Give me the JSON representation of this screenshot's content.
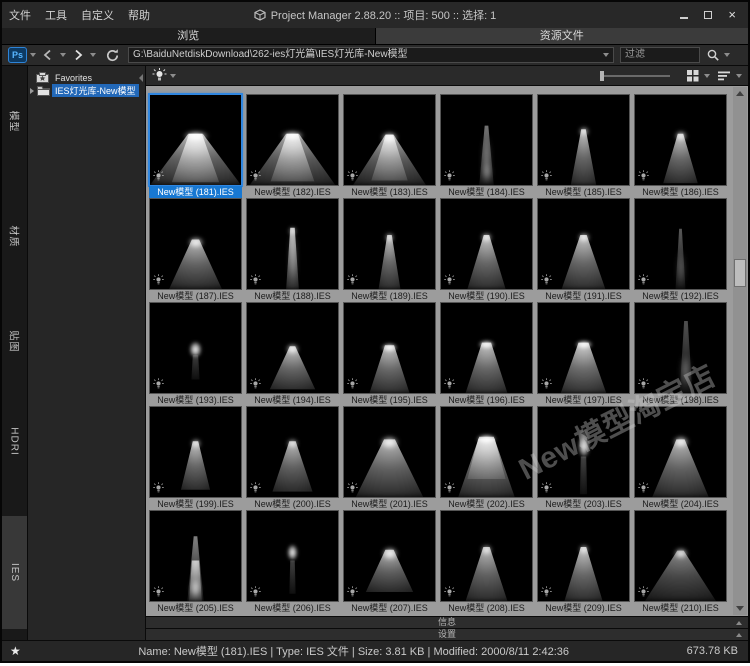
{
  "window": {
    "title": "Project Manager 2.88.20  ::  项目: 500  ::  选择: 1",
    "close": "×"
  },
  "menu": {
    "items": [
      "文件",
      "工具",
      "自定义",
      "帮助"
    ]
  },
  "tabs": [
    {
      "label": "浏览",
      "active": true
    },
    {
      "label": "资源文件",
      "active": false
    }
  ],
  "toolbar": {
    "ps_label": "Ps",
    "path": "G:\\BaiduNetdiskDownload\\262-ies灯光篇\\IES灯光库-New模型",
    "filter_placeholder": "过滤"
  },
  "side_tabs": [
    {
      "label": "模型",
      "active": false
    },
    {
      "label": "材质",
      "active": false
    },
    {
      "label": "贴图",
      "active": false
    },
    {
      "label": "HDRI",
      "active": false
    },
    {
      "label": "IES",
      "active": true
    }
  ],
  "tree": {
    "favorites": "Favorites",
    "folder": "IES灯光库-New模型"
  },
  "panels": {
    "info": "信息",
    "settings": "设置"
  },
  "status": {
    "star": "★",
    "text": "Name: New模型 (181).IES | Type: IES 文件 | Size: 3.81 KB | Modified: 2000/8/11 2:42:36",
    "total_size": "673.78 KB"
  },
  "watermark": "New模型淘宝店",
  "colors": {
    "selection_blue": "#1878d2",
    "grid_bg": "#9c9c9c",
    "thumb_bg": "#000000",
    "accent_border": "#2f86e0"
  },
  "items": [
    {
      "label": "New模型 (181).IES",
      "selected": true,
      "layers": [
        [
          "cone",
          43,
          16,
          100,
          100,
          0.75,
          3,
          0
        ],
        [
          "cone",
          43,
          14,
          52,
          97,
          0.9,
          3,
          0
        ],
        [
          "cap",
          50,
          45,
          26,
          10,
          1,
          2
        ]
      ]
    },
    {
      "label": "New模型 (182).IES",
      "layers": [
        [
          "cone",
          43,
          14,
          94,
          100,
          0.7,
          3,
          0
        ],
        [
          "cone",
          43,
          12,
          48,
          96,
          0.85,
          3,
          0
        ],
        [
          "cap",
          50,
          45,
          23,
          9,
          1,
          2
        ]
      ]
    },
    {
      "label": "New模型 (183).IES",
      "layers": [
        [
          "cone",
          44,
          9,
          80,
          100,
          0.7,
          3,
          0
        ],
        [
          "cone",
          44,
          8,
          40,
          95,
          0.8,
          3,
          0
        ],
        [
          "blob",
          50,
          47,
          17,
          11,
          0.95,
          2
        ]
      ]
    },
    {
      "label": "New模型 (184).IES",
      "layers": [
        [
          "cone",
          34,
          4,
          16,
          100,
          0.5,
          2,
          0
        ],
        [
          "blob",
          50,
          72,
          7,
          48,
          0.45,
          3
        ],
        [
          "blob",
          50,
          86,
          8,
          20,
          0.45,
          3
        ]
      ]
    },
    {
      "label": "New模型 (185).IES",
      "layers": [
        [
          "cone",
          38,
          5,
          28,
          100,
          0.8,
          2,
          0
        ],
        [
          "blob",
          50,
          41,
          10,
          9,
          0.9,
          2
        ]
      ]
    },
    {
      "label": "New模型 (186).IES",
      "layers": [
        [
          "cone",
          43,
          6,
          38,
          98,
          0.8,
          2,
          0
        ],
        [
          "blob",
          50,
          46,
          12,
          10,
          0.95,
          2
        ]
      ]
    },
    {
      "label": "New模型 (187).IES",
      "layers": [
        [
          "cone",
          45,
          8,
          58,
          100,
          0.75,
          3,
          0
        ],
        [
          "blob",
          50,
          48,
          16,
          11,
          0.95,
          2
        ]
      ]
    },
    {
      "label": "New模型 (188).IES",
      "layers": [
        [
          "cone",
          32,
          5,
          14,
          100,
          0.85,
          2,
          0
        ],
        [
          "blob",
          50,
          36,
          7,
          8,
          0.9,
          2
        ],
        [
          "blob",
          50,
          64,
          6,
          54,
          0.5,
          3
        ]
      ]
    },
    {
      "label": "New模型 (189).IES",
      "layers": [
        [
          "cone",
          40,
          5,
          24,
          100,
          0.8,
          2,
          0
        ],
        [
          "blob",
          50,
          43,
          9,
          9,
          0.9,
          2
        ]
      ]
    },
    {
      "label": "New模型 (190).IES",
      "layers": [
        [
          "cone",
          40,
          6,
          42,
          100,
          0.8,
          2,
          0
        ],
        [
          "blob",
          50,
          43,
          11,
          9,
          0.95,
          2
        ]
      ]
    },
    {
      "label": "New模型 (191).IES",
      "layers": [
        [
          "cone",
          40,
          7,
          48,
          100,
          0.8,
          2,
          0
        ],
        [
          "blob",
          50,
          43,
          12,
          9,
          0.95,
          2
        ]
      ]
    },
    {
      "label": "New模型 (192).IES",
      "layers": [
        [
          "cone",
          33,
          3,
          11,
          100,
          0.4,
          2,
          0
        ],
        [
          "blob",
          50,
          78,
          6,
          36,
          0.35,
          3
        ]
      ]
    },
    {
      "label": "New模型 (193).IES",
      "layers": [
        [
          "blob",
          50,
          52,
          13,
          17,
          1,
          1.5
        ],
        [
          "cone",
          58,
          6,
          9,
          85,
          0.3,
          3,
          0
        ]
      ]
    },
    {
      "label": "New模型 (194).IES",
      "layers": [
        [
          "cone",
          48,
          6,
          50,
          96,
          0.8,
          2,
          0
        ],
        [
          "blob",
          50,
          51,
          13,
          10,
          0.95,
          2
        ]
      ]
    },
    {
      "label": "New模型 (195).IES",
      "layers": [
        [
          "cone",
          47,
          10,
          44,
          100,
          0.8,
          2,
          0
        ],
        [
          "cap",
          50,
          49,
          17,
          9,
          1,
          1.5
        ]
      ]
    },
    {
      "label": "New模型 (196).IES",
      "layers": [
        [
          "cone",
          44,
          10,
          46,
          100,
          0.8,
          2,
          0
        ],
        [
          "cap",
          50,
          46,
          17,
          9,
          1,
          1.5
        ]
      ]
    },
    {
      "label": "New模型 (197).IES",
      "layers": [
        [
          "cone",
          44,
          11,
          50,
          100,
          0.85,
          2,
          0
        ],
        [
          "cap",
          50,
          46,
          18,
          9,
          1,
          1.5
        ]
      ]
    },
    {
      "label": "New模型 (198).IES",
      "layers": [
        [
          "cone",
          20,
          4,
          14,
          100,
          0.35,
          2,
          6
        ],
        [
          "blob",
          56,
          76,
          9,
          34,
          0.4,
          3
        ]
      ]
    },
    {
      "label": "New模型 (199).IES",
      "layers": [
        [
          "cone",
          38,
          6,
          32,
          92,
          0.8,
          2,
          0
        ],
        [
          "blob",
          50,
          41,
          10,
          9,
          0.9,
          2
        ]
      ]
    },
    {
      "label": "New模型 (200).IES",
      "layers": [
        [
          "cone",
          38,
          7,
          44,
          94,
          0.75,
          2,
          0
        ],
        [
          "blob",
          50,
          41,
          11,
          9,
          0.9,
          2
        ]
      ]
    },
    {
      "label": "New模型 (201).IES",
      "layers": [
        [
          "cone",
          36,
          12,
          74,
          100,
          0.75,
          3,
          0
        ],
        [
          "blob",
          50,
          39,
          19,
          13,
          0.95,
          2
        ]
      ]
    },
    {
      "label": "New模型 (202).IES",
      "layers": [
        [
          "cone",
          33,
          16,
          62,
          100,
          0.8,
          3,
          0
        ],
        [
          "cone",
          35,
          18,
          42,
          80,
          0.7,
          3,
          0
        ],
        [
          "cap",
          50,
          35,
          21,
          10,
          1,
          1.5
        ]
      ]
    },
    {
      "label": "New模型 (203).IES",
      "layers": [
        [
          "blob",
          50,
          43,
          12,
          24,
          1,
          1.5
        ],
        [
          "blob",
          50,
          30,
          7,
          10,
          0.5,
          2
        ],
        [
          "cone",
          55,
          6,
          8,
          97,
          0.35,
          3,
          0
        ]
      ]
    },
    {
      "label": "New模型 (204).IES",
      "layers": [
        [
          "cone",
          36,
          9,
          62,
          100,
          0.75,
          3,
          0
        ],
        [
          "blob",
          50,
          39,
          16,
          12,
          0.95,
          2
        ]
      ]
    },
    {
      "label": "New模型 (205).IES",
      "layers": [
        [
          "cone",
          28,
          4,
          18,
          100,
          0.55,
          2,
          0
        ],
        [
          "cone",
          55,
          8,
          14,
          100,
          0.8,
          2,
          0
        ],
        [
          "blob",
          50,
          86,
          11,
          20,
          0.65,
          2
        ]
      ]
    },
    {
      "label": "New模型 (206).IES",
      "layers": [
        [
          "blob",
          50,
          46,
          11,
          17,
          1,
          1.5
        ],
        [
          "cone",
          55,
          5,
          7,
          92,
          0.35,
          3,
          0
        ]
      ]
    },
    {
      "label": "New模型 (207).IES",
      "layers": [
        [
          "cone",
          43,
          9,
          52,
          90,
          0.75,
          3,
          0
        ],
        [
          "blob",
          50,
          47,
          16,
          13,
          0.95,
          2
        ]
      ]
    },
    {
      "label": "New模型 (208).IES",
      "layers": [
        [
          "cone",
          40,
          7,
          46,
          100,
          0.75,
          2,
          0
        ],
        [
          "blob",
          50,
          43,
          11,
          10,
          0.9,
          2
        ]
      ]
    },
    {
      "label": "New模型 (209).IES",
      "layers": [
        [
          "cone",
          40,
          6,
          42,
          100,
          0.8,
          2,
          0
        ],
        [
          "blob",
          50,
          43,
          10,
          9,
          0.9,
          2
        ]
      ]
    },
    {
      "label": "New模型 (210).IES",
      "layers": [
        [
          "cone",
          44,
          7,
          78,
          100,
          0.55,
          3,
          0
        ],
        [
          "blob",
          50,
          47,
          14,
          11,
          0.95,
          2
        ]
      ]
    }
  ]
}
